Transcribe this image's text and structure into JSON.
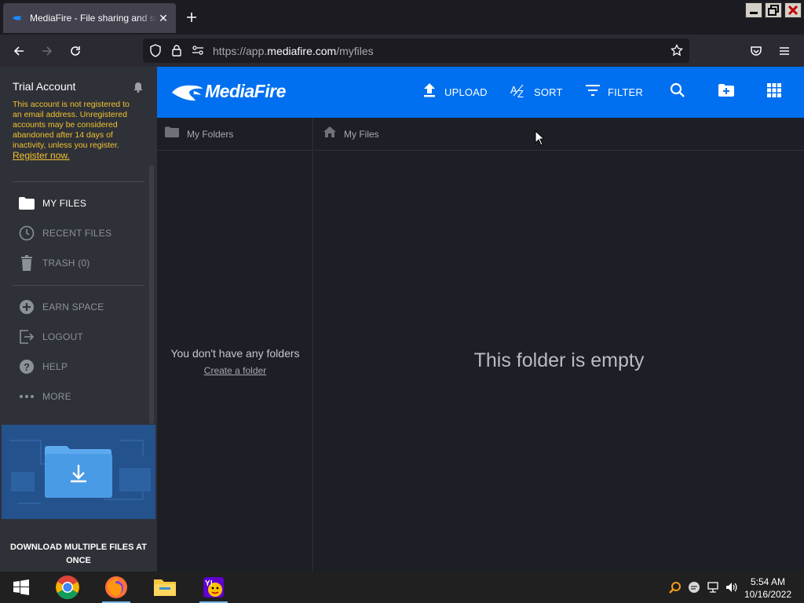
{
  "browser": {
    "tab_title": "MediaFire - File sharing and storage",
    "url_scheme": "https://app.",
    "url_host": "mediafire.com",
    "url_path": "/myfiles"
  },
  "sidebar": {
    "account_title": "Trial Account",
    "account_message": "This account is not registered to an email address. Unregistered accounts may be considered abandoned after 14 days of inactivity, unless you register.",
    "register_link": "Register now.",
    "nav": [
      {
        "label": "MY FILES",
        "icon": "folder-icon"
      },
      {
        "label": "RECENT FILES",
        "icon": "clock-icon"
      },
      {
        "label": "TRASH (0)",
        "icon": "trash-icon"
      }
    ],
    "actions": [
      {
        "label": "EARN SPACE",
        "icon": "plus-circle-icon"
      },
      {
        "label": "LOGOUT",
        "icon": "logout-icon"
      },
      {
        "label": "HELP",
        "icon": "help-icon"
      },
      {
        "label": "MORE",
        "icon": "more-icon"
      }
    ],
    "promo_text": "DOWNLOAD MULTIPLE FILES AT ONCE"
  },
  "header": {
    "logo_text": "MediaFire",
    "upload": "UPLOAD",
    "sort": "SORT",
    "filter": "FILTER"
  },
  "folders": {
    "heading": "My Folders",
    "empty_message": "You don't have any folders",
    "create_link": "Create a folder"
  },
  "files": {
    "breadcrumb": "My Files",
    "empty_message": "This folder is empty"
  },
  "taskbar": {
    "time": "5:54 AM",
    "date": "10/16/2022"
  },
  "colors": {
    "brand_blue": "#0070f0",
    "warning_yellow": "#f2c230",
    "sidebar_bg": "#2f3138",
    "content_bg": "#1d1f26"
  }
}
